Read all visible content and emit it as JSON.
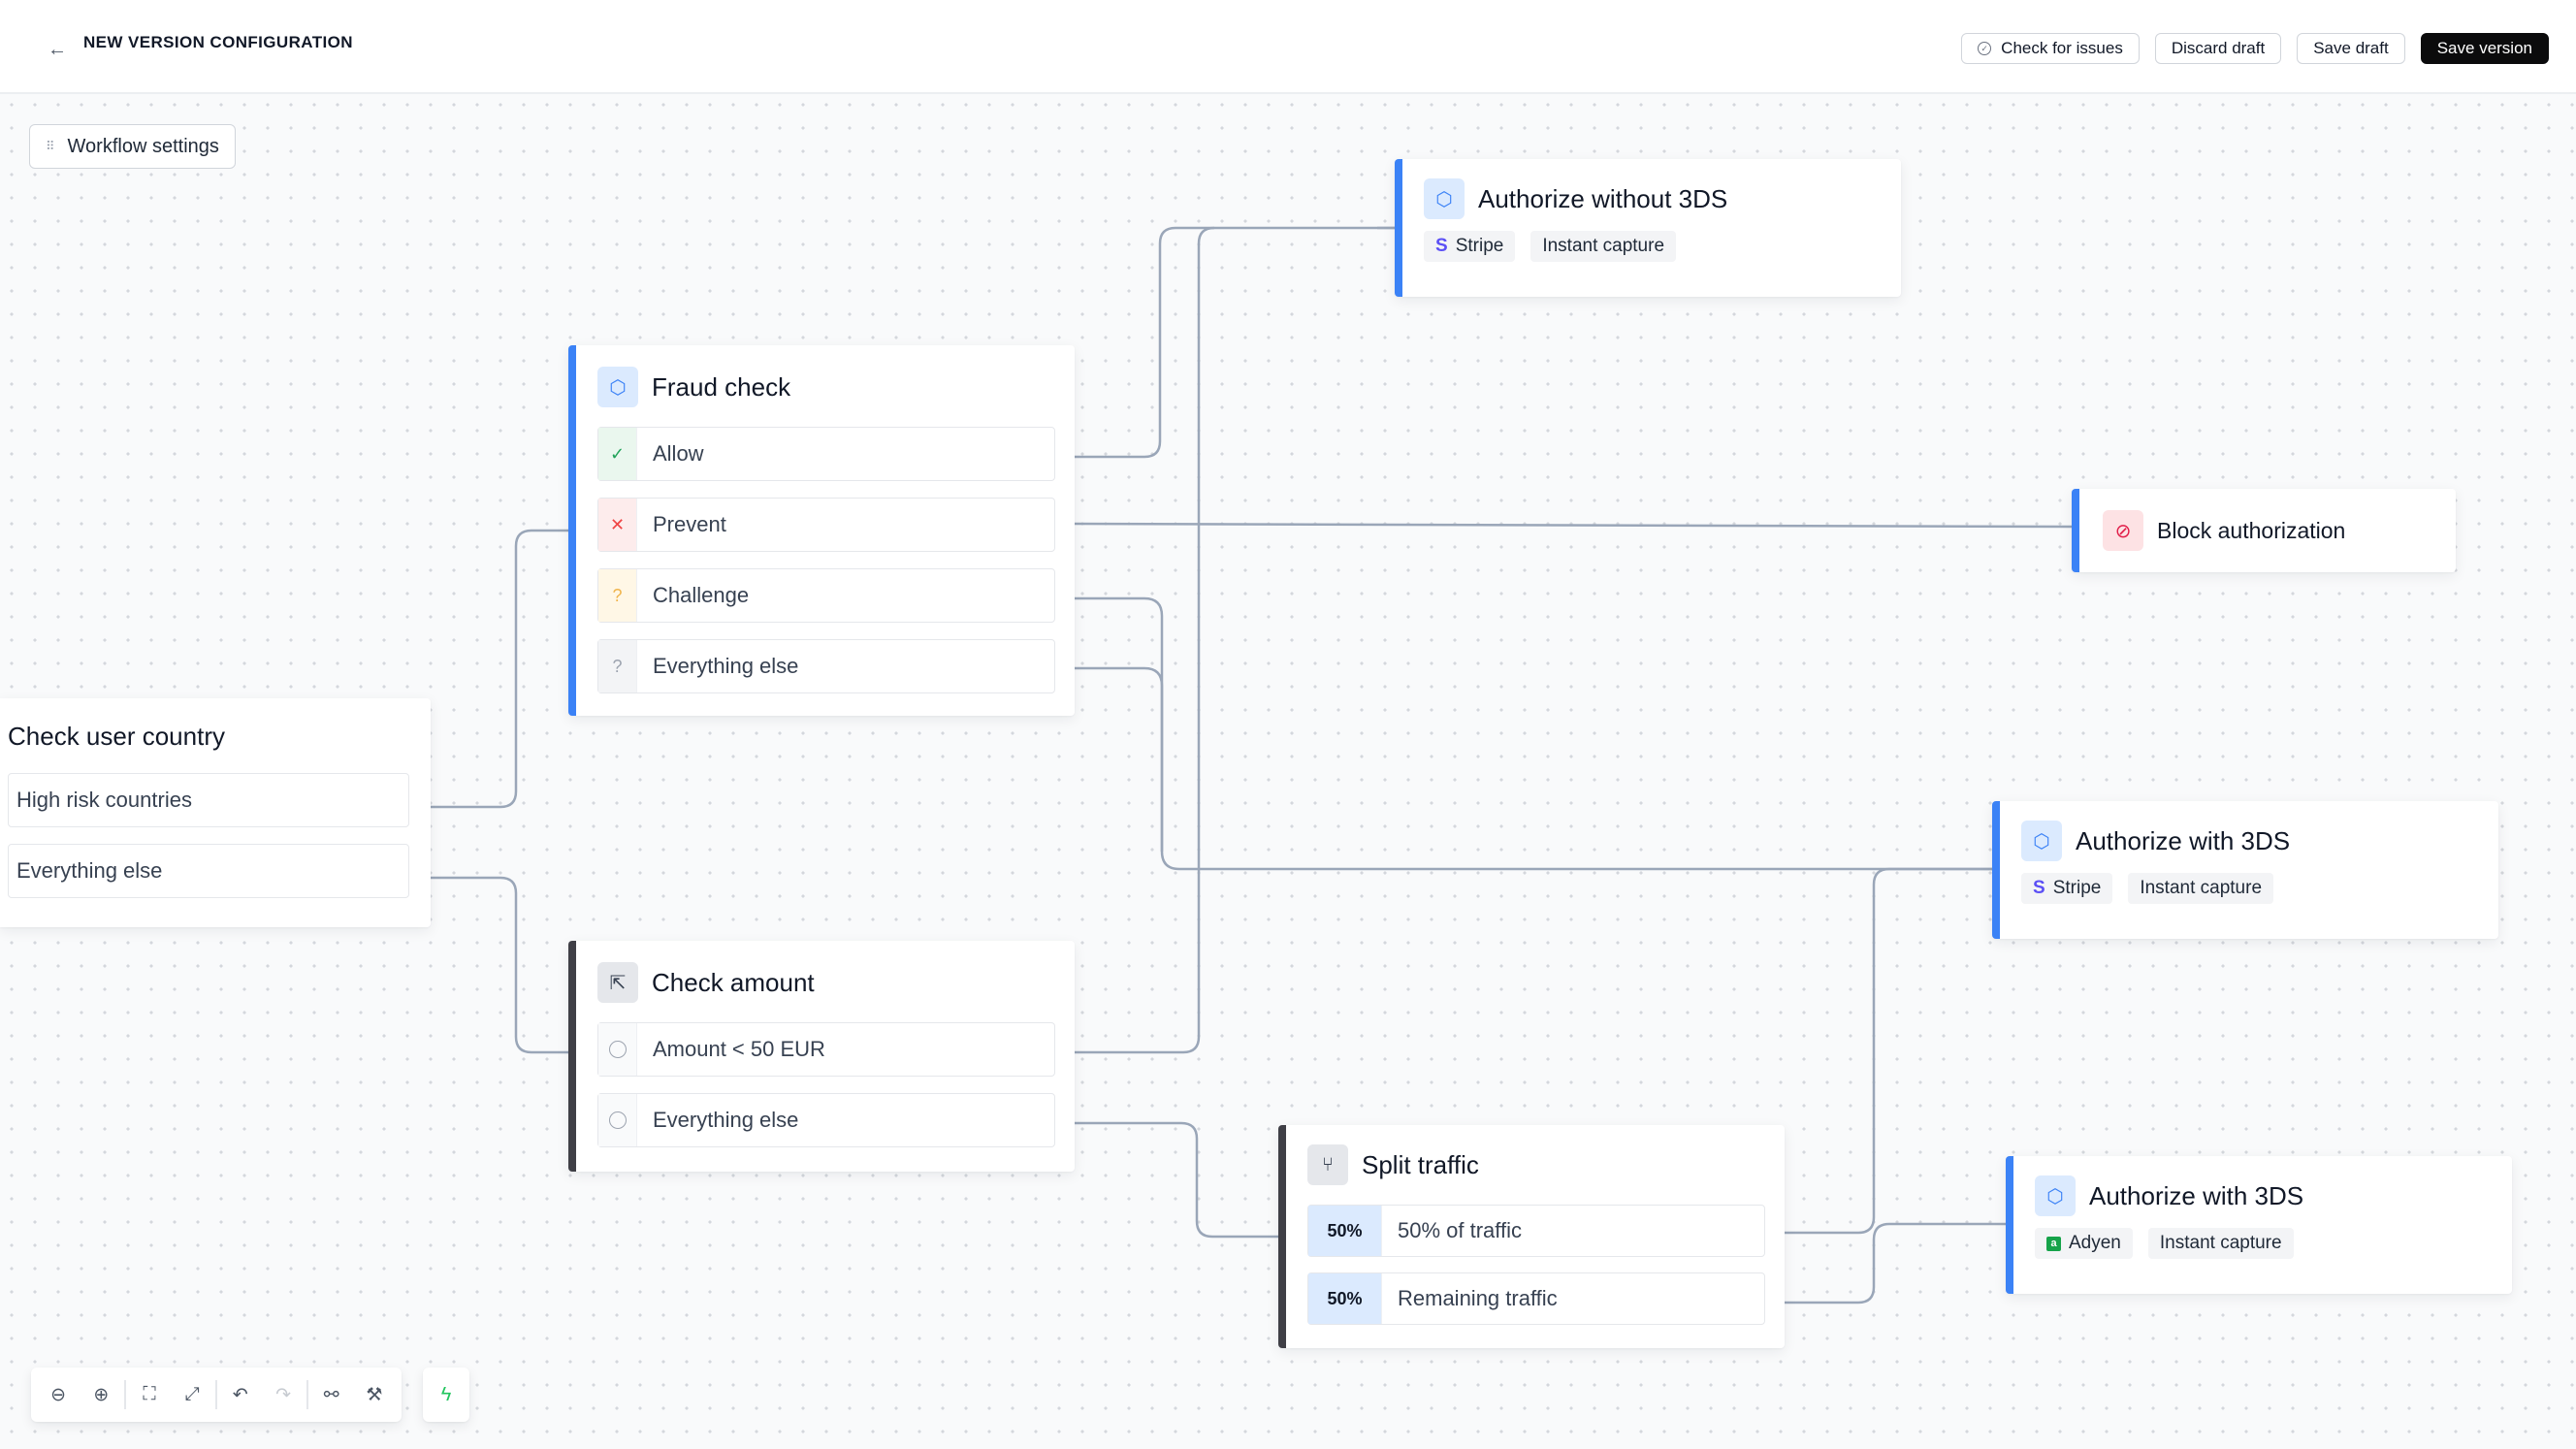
{
  "header": {
    "title": "NEW VERSION CONFIGURATION",
    "back_icon": "←",
    "check_issues_label": "Check for issues",
    "discard_label": "Discard draft",
    "save_draft_label": "Save draft",
    "save_version_label": "Save version"
  },
  "workflow_settings_label": "Workflow settings",
  "nodes": {
    "country": {
      "title": "Check user country",
      "options": [
        "High risk countries",
        "Everything else"
      ]
    },
    "fraud": {
      "title": "Fraud check",
      "options": [
        {
          "label": "Allow",
          "icon": "✓"
        },
        {
          "label": "Prevent",
          "icon": "✕"
        },
        {
          "label": "Challenge",
          "icon": "?"
        },
        {
          "label": "Everything else",
          "icon": "?"
        }
      ]
    },
    "amount": {
      "title": "Check amount",
      "options": [
        "Amount < 50 EUR",
        "Everything else"
      ]
    },
    "split": {
      "title": "Split traffic",
      "options": [
        {
          "pct": "50%",
          "label": "50% of traffic"
        },
        {
          "pct": "50%",
          "label": "Remaining traffic"
        }
      ]
    },
    "auth_no3ds": {
      "title": "Authorize without 3DS",
      "provider": "Stripe",
      "capture": "Instant capture"
    },
    "block": {
      "title": "Block authorization"
    },
    "auth_3ds_stripe": {
      "title": "Authorize with 3DS",
      "provider": "Stripe",
      "capture": "Instant capture"
    },
    "auth_3ds_adyen": {
      "title": "Authorize with 3DS",
      "provider": "Adyen",
      "capture": "Instant capture"
    }
  },
  "colors": {
    "accent_blue": "#3b82f6",
    "dark_border": "#3f3f46",
    "connector": "#9aa6b8",
    "primary_button": "#0b0b0c"
  }
}
